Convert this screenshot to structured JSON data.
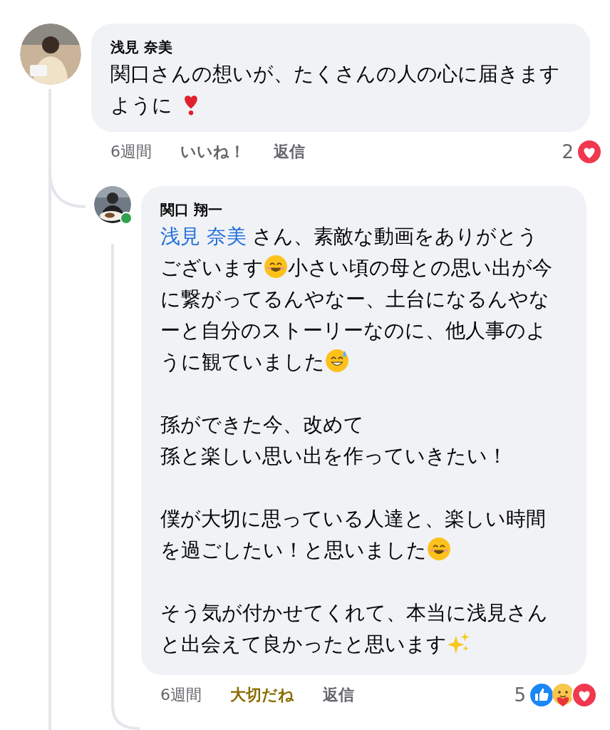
{
  "comments": [
    {
      "author": "浅見 奈美",
      "paragraphs": [
        [
          {
            "kind": "text",
            "text": "関口さんの想いが、たくさんの人の心に届きますように "
          },
          {
            "kind": "heart-exclamation"
          }
        ]
      ],
      "time": "6週間",
      "like": {
        "label": "いいね！",
        "reacted": false
      },
      "reply_label": "返信",
      "reaction_count": "2",
      "reactions": [
        {
          "kind": "love"
        }
      ],
      "replies": [
        {
          "author": "関口 翔一",
          "online": true,
          "paragraphs": [
            [
              {
                "kind": "mention",
                "text": "浅見 奈美"
              },
              {
                "kind": "text",
                "text": " さん、素敵な動画をありがとうございます"
              },
              {
                "kind": "smile"
              },
              {
                "kind": "text",
                "text": "小さい頃の母との思い出が今に繋がってるんやなー、土台になるんやなーと自分のストーリーなのに、他人事のように観ていました"
              },
              {
                "kind": "sweat-smile"
              }
            ],
            [
              {
                "kind": "text",
                "text": "孫ができた今、改めて"
              },
              {
                "kind": "break"
              },
              {
                "kind": "text",
                "text": "孫と楽しい思い出を作っていきたい！"
              }
            ],
            [
              {
                "kind": "text",
                "text": "僕が大切に思っている人達と、楽しい時間を過ごしたい！と思いました"
              },
              {
                "kind": "smile"
              }
            ],
            [
              {
                "kind": "text",
                "text": "そう気が付かせてくれて、本当に浅見さんと出会えて良かったと思います"
              },
              {
                "kind": "sparkles"
              }
            ]
          ],
          "time": "6週間",
          "like": {
            "label": "大切だね",
            "reacted": true,
            "kind": "care"
          },
          "reply_label": "返信",
          "reaction_count": "5",
          "reactions": [
            {
              "kind": "like"
            },
            {
              "kind": "care"
            },
            {
              "kind": "love"
            }
          ]
        }
      ]
    }
  ]
}
